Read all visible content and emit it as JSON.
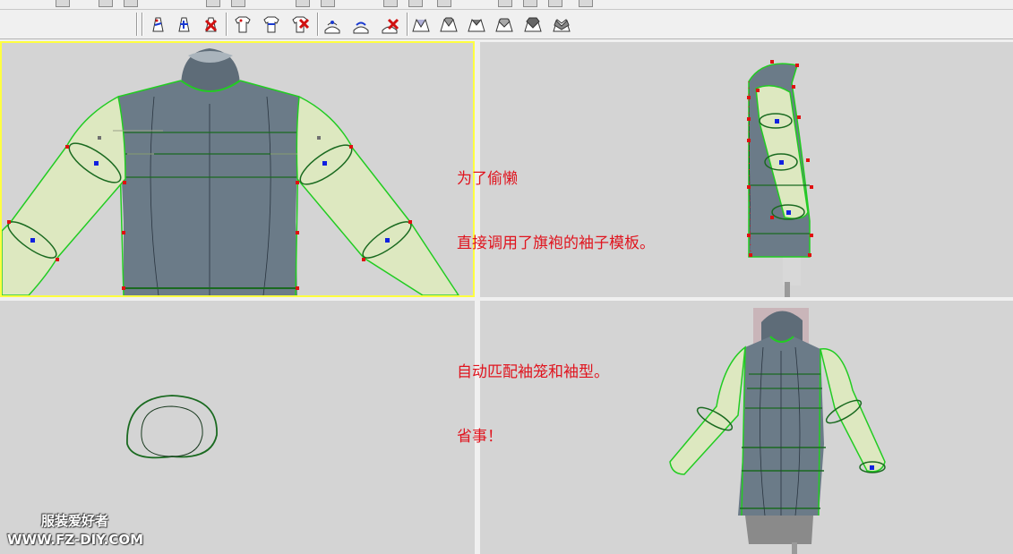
{
  "app": {
    "toolbar_icons": [
      "pattern-add-icon",
      "pattern-move-icon",
      "pattern-delete-icon",
      "shirt-add-icon",
      "shirt-move-icon",
      "shirt-delete-icon",
      "collar-add-icon",
      "collar-move-icon",
      "collar-delete-icon",
      "collar-style-1-icon",
      "collar-style-2-icon",
      "collar-style-3-icon",
      "collar-style-4-icon",
      "collar-style-5-icon",
      "collar-style-6-icon"
    ]
  },
  "viewports": {
    "front": {
      "label": "front-view",
      "active": true
    },
    "side": {
      "label": "side-view"
    },
    "top": {
      "label": "top-view"
    },
    "perspective": {
      "label": "perspective-view"
    }
  },
  "annotation": {
    "lines": [
      "为了偷懒",
      "直接调用了旗袍的袖子模板。",
      "",
      "自动匹配袖笼和袖型。",
      "省事！"
    ],
    "color": "#e0141e"
  },
  "watermark": {
    "line1": "服装爱好者",
    "line2": "WWW.FZ-DIY.COM"
  },
  "colors": {
    "viewport_bg": "#d4d4d4",
    "active_border": "#ffff40",
    "outline_green": "#22cc22",
    "control_point_red": "#e01010",
    "control_point_blue": "#1020e0",
    "sleeve_fill": "#dde8c0",
    "mannequin": "#6a7a86"
  }
}
